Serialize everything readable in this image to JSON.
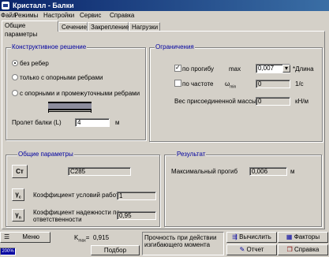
{
  "window": {
    "title": "Кристалл - Балки"
  },
  "menu": [
    "Файл",
    "Режимы",
    "Настройки",
    "Сервис",
    "Справка"
  ],
  "tabs": [
    "Общие параметры",
    "Сечение",
    "Закрепление",
    "Нагрузки"
  ],
  "construct": {
    "title": "Конструктивное решение",
    "options": [
      "без ребер",
      "только с опорными ребрами",
      "с опорными и промежуточными ребрами"
    ],
    "selected": 0,
    "span_label": "Пролет балки (L)",
    "span_value": "4",
    "span_unit": "м"
  },
  "limits": {
    "title": "Ограничения",
    "deflection_label": "по прогибу",
    "deflection_checked": true,
    "max_label": "max",
    "max_value": "0,007",
    "length_label": "*Длина",
    "frequency_label": "по частоте",
    "omega_label": "ω",
    "omega_sub": "min",
    "omega_value": "0",
    "omega_unit": "1/с",
    "mass_label": "Вес присоединенной массы",
    "mass_value": "0",
    "mass_unit": "кН/м"
  },
  "general": {
    "title": "Общие параметры",
    "steel_icon": "Ст",
    "steel_value": "C285",
    "gamma_c_label": "Коэффициент условий работы",
    "gamma_c_value": "1",
    "gamma_n_label_1": "Коэффициент надежности по",
    "gamma_n_label_2": "ответственности",
    "gamma_n_value": "0,95"
  },
  "result": {
    "title": "Результат",
    "max_deflection_label": "Максимальный прогиб",
    "max_deflection_value": "0,006",
    "max_deflection_unit": "м"
  },
  "bottom": {
    "menu_label": "Меню",
    "kmax_label": "K",
    "kmax_sub": "max",
    "kmax_eq": "=",
    "kmax_value": "0,915",
    "select_label": "Подбор",
    "status_line1": "Прочность при действии",
    "status_line2": "изгибающего момента",
    "calc_label": "Вычислить",
    "factors_label": "Факторы",
    "report_label": "Отчет",
    "help_label": "Справка",
    "corner_label": "200%"
  }
}
